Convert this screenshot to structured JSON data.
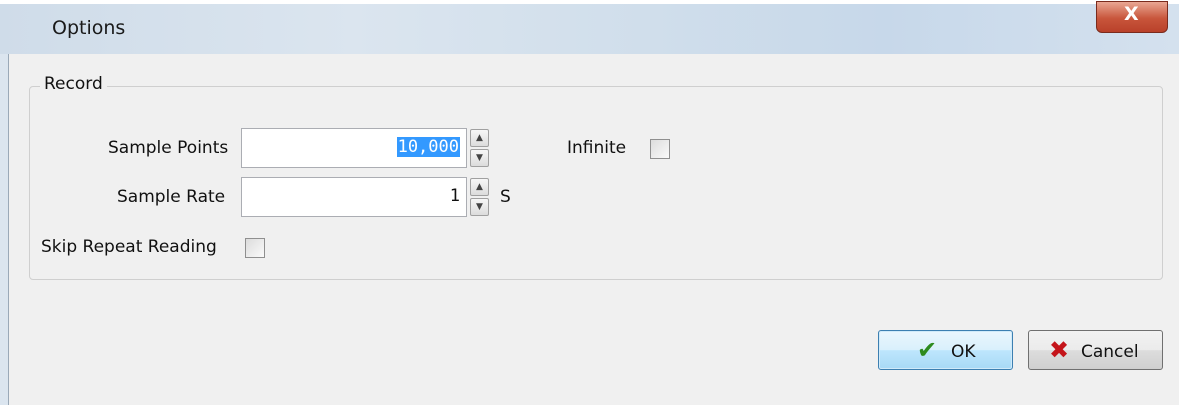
{
  "window": {
    "title": "Options",
    "close_glyph": "X"
  },
  "record": {
    "group_label": "Record",
    "sample_points": {
      "label": "Sample Points",
      "value": "10,000"
    },
    "sample_rate": {
      "label": "Sample Rate",
      "value": "1",
      "unit": "S"
    },
    "infinite": {
      "label": "Infinite",
      "checked": false
    },
    "skip_repeat": {
      "label": "Skip Repeat Reading",
      "checked": false
    }
  },
  "buttons": {
    "ok": {
      "label": "OK",
      "icon": "checkmark-icon",
      "icon_color": "#2e8b1e"
    },
    "cancel": {
      "label": "Cancel",
      "icon": "x-icon",
      "icon_color": "#c4141a"
    }
  }
}
